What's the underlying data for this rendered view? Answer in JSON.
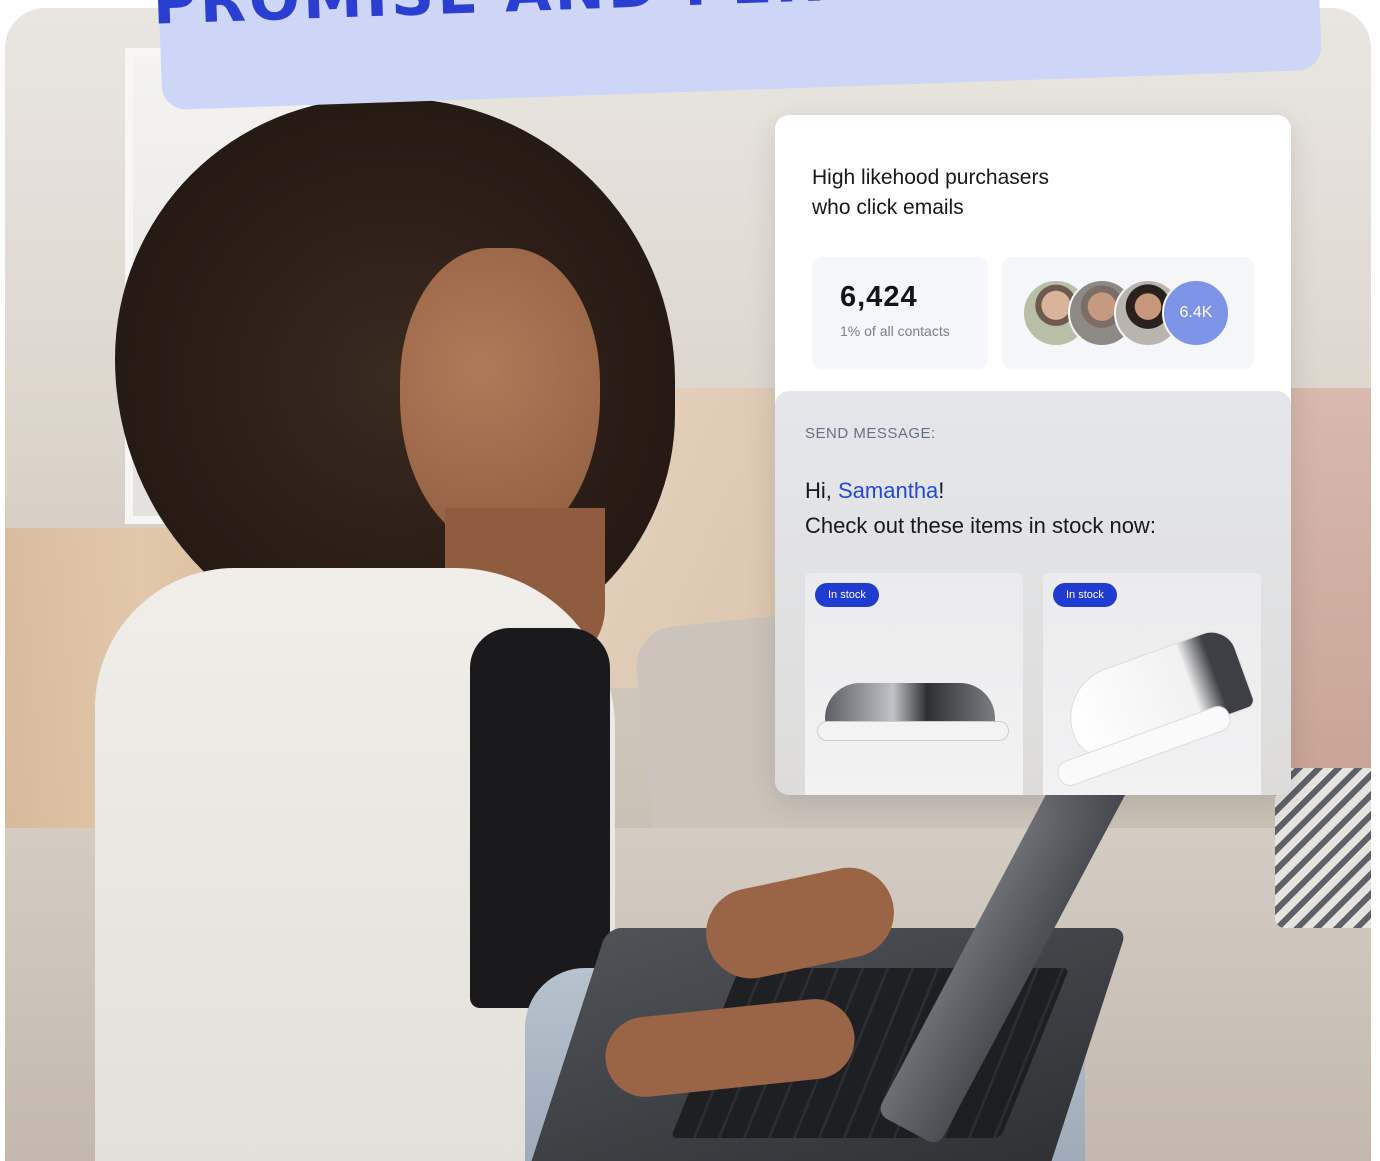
{
  "banner": {
    "headline": "PROMISE AND PERFORMANCE"
  },
  "card": {
    "title_line1": "High likehood purchasers",
    "title_line2": "who click emails",
    "stat": {
      "value": "6,424",
      "subtitle": "1% of all contacts"
    },
    "avatars": {
      "count_label": "6.4K"
    },
    "message": {
      "label": "SEND MESSAGE:",
      "greeting_prefix": "Hi, ",
      "recipient": "Samantha",
      "greeting_suffix": "!",
      "body": "Check out these items in stock now:"
    },
    "products": [
      {
        "badge": "In stock"
      },
      {
        "badge": "In stock"
      }
    ]
  },
  "colors": {
    "accent": "#2547d6",
    "banner_bg": "#cdd6f7",
    "banner_text": "#2a3fd1",
    "badge_bg": "#1f3bd0",
    "avatar_count_bg": "#7d93e6"
  }
}
